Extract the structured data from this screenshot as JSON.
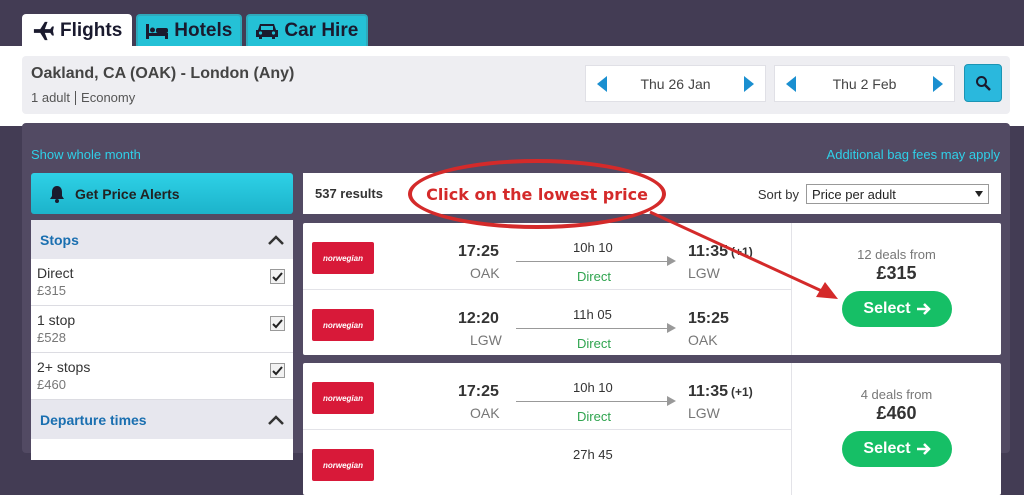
{
  "tabs": [
    {
      "label": "Flights",
      "icon": "plane-icon",
      "active": true
    },
    {
      "label": "Hotels",
      "icon": "bed-icon",
      "active": false
    },
    {
      "label": "Car Hire",
      "icon": "car-icon",
      "active": false
    }
  ],
  "search": {
    "route": "Oakland, CA (OAK) - London (Any)",
    "passengers": "1 adult",
    "cabin": "Economy",
    "depart_date": "Thu 26 Jan",
    "return_date": "Thu 2 Feb"
  },
  "links": {
    "show_month": "Show whole month",
    "bag_fees": "Additional bag fees may apply"
  },
  "price_alerts": {
    "label": "Get Price Alerts"
  },
  "filters": {
    "stops_title": "Stops",
    "stops": [
      {
        "name": "Direct",
        "price": "£315",
        "checked": true
      },
      {
        "name": "1 stop",
        "price": "£528",
        "checked": true
      },
      {
        "name": "2+ stops",
        "price": "£460",
        "checked": true
      }
    ],
    "departure_title": "Departure times"
  },
  "results": {
    "count": "537 results",
    "sort_label": "Sort by",
    "sort_value": "Price per adult"
  },
  "annotation": {
    "text": "Click on the lowest price"
  },
  "cards": [
    {
      "airline": "norwegian",
      "legs": [
        {
          "dep_time": "17:25",
          "dep_airport": "OAK",
          "duration": "10h 10",
          "stops": "Direct",
          "arr_time": "11:35",
          "day_offset": "(+1)",
          "arr_airport": "LGW"
        },
        {
          "dep_time": "12:20",
          "dep_airport": "LGW",
          "duration": "11h 05",
          "stops": "Direct",
          "arr_time": "15:25",
          "day_offset": "",
          "arr_airport": "OAK"
        }
      ],
      "deals": "12 deals from",
      "price": "£315",
      "select_label": "Select"
    },
    {
      "airline": "norwegian",
      "legs": [
        {
          "dep_time": "17:25",
          "dep_airport": "OAK",
          "duration": "10h 10",
          "stops": "Direct",
          "arr_time": "11:35",
          "day_offset": "(+1)",
          "arr_airport": "LGW"
        },
        {
          "dep_time": "",
          "dep_airport": "",
          "duration": "27h 45",
          "stops": "",
          "arr_time": "",
          "day_offset": "",
          "arr_airport": ""
        }
      ],
      "deals": "4 deals from",
      "price": "£460",
      "select_label": "Select"
    }
  ],
  "colors": {
    "accent": "#24c1d6",
    "background": "#433c54",
    "select_green": "#16bf66",
    "airline_red": "#d81939",
    "annotation_red": "#d42a2a"
  }
}
